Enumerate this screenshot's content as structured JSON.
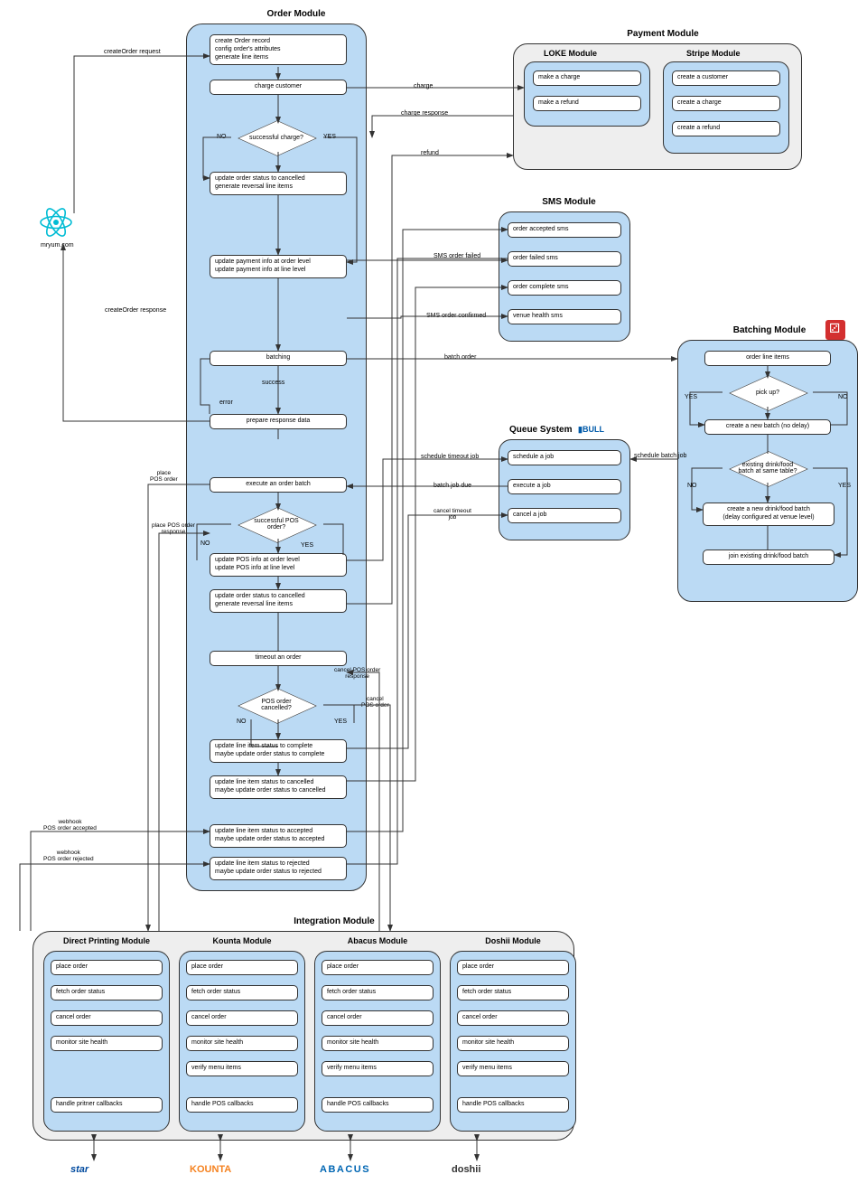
{
  "order_module": {
    "title": "Order Module",
    "items": {
      "create": "create Order record\nconfig order's attributes\ngenerate line items",
      "charge": "charge customer",
      "q_charge": "successful charge?",
      "cancel1": "update order status to cancelled\ngenerate reversal line items",
      "payinfo": "update payment info at order level\nupdate payment info at line level",
      "batching": "batching",
      "success": "success",
      "error": "error",
      "prepare": "prepare response data",
      "exec_batch": "execute an order batch",
      "q_pos": "successful POS\norder?",
      "pos_info": "update POS info at order level\nupdate POS info at line level",
      "cancel2": "update order status to cancelled\ngenerate reversal line items",
      "timeout": "timeout an order",
      "q_cancelled": "POS order\ncancelled?",
      "complete": "update line item status to complete\nmaybe update order status to complete",
      "cancelled_box": "update line item status to cancelled\nmaybe update order status to cancelled",
      "accepted_box": "update line item status to accepted\nmaybe update order status to accepted",
      "rejected_box": "update line item status to rejected\nmaybe update order status to rejected"
    }
  },
  "payment_module": {
    "title": "Payment Module",
    "loke_title": "LOKE Module",
    "stripe_title": "Stripe Module",
    "loke": [
      "make a charge",
      "make a refund"
    ],
    "stripe": [
      "create a customer",
      "create a charge",
      "create a refund"
    ]
  },
  "sms_module": {
    "title": "SMS Module",
    "items": [
      "order accepted sms",
      "order failed sms",
      "order complete sms",
      "venue health sms"
    ]
  },
  "queue_module": {
    "title": "Queue System",
    "logo": "BULL",
    "items": [
      "schedule a job",
      "execute a job",
      "cancel a job"
    ]
  },
  "batching_module": {
    "title": "Batching Module",
    "items": {
      "order_items": "order line items",
      "q_pickup": "pick up?",
      "new_batch": "create a new batch (no delay)",
      "q_existing": "existing drink/food\nbatch at same table?",
      "new_drink": "create a new drink/food batch\n(delay configured at venue level)",
      "join": "join existing drink/food batch"
    }
  },
  "integration_module": {
    "title": "Integration Module",
    "submodules": [
      {
        "title": "Direct Printing Module",
        "items": [
          "place order",
          "fetch order status",
          "cancel order",
          "monitor site health",
          "",
          "handle pritner callbacks"
        ],
        "logo": "star",
        "color": "#004a9f"
      },
      {
        "title": "Kounta Module",
        "items": [
          "place order",
          "fetch order status",
          "cancel order",
          "monitor site health",
          "verify menu items",
          "handle POS callbacks"
        ],
        "logo": "KOUNTA",
        "color": "#f58220"
      },
      {
        "title": "Abacus Module",
        "items": [
          "place order",
          "fetch order status",
          "cancel order",
          "monitor site health",
          "verify menu items",
          "handle POS callbacks"
        ],
        "logo": "ABACUS",
        "color": "#0066b3"
      },
      {
        "title": "Doshii Module",
        "items": [
          "place order",
          "fetch order status",
          "cancel order",
          "monitor site health",
          "verify menu items",
          "handle POS callbacks"
        ],
        "logo": "doshii",
        "color": "#333"
      }
    ]
  },
  "labels": {
    "yes": "YES",
    "no": "NO",
    "createOrder_req": "createOrder request",
    "createOrder_res": "createOrder response",
    "mryum": "mryum.com",
    "charge": "charge",
    "charge_resp": "charge response",
    "refund": "refund",
    "sms_failed": "SMS order failed",
    "sms_confirmed": "SMS order confirmed",
    "batch_order": "batch order",
    "schedule_timeout": "schedule timeout job",
    "batch_job_due": "batch job due",
    "cancel_timeout": "cancel timeout\njob",
    "schedule_batch": "schedule batch job",
    "place_pos": "place\nPOS order",
    "place_pos_resp": "place POS order\nresponse",
    "cancel_pos": "cancel\nPOS order",
    "cancel_pos_resp": "cancel POS order\nresponse",
    "webhook_accepted": "webhook\nPOS order accepted",
    "webhook_rejected": "webhook\nPOS order rejected"
  }
}
